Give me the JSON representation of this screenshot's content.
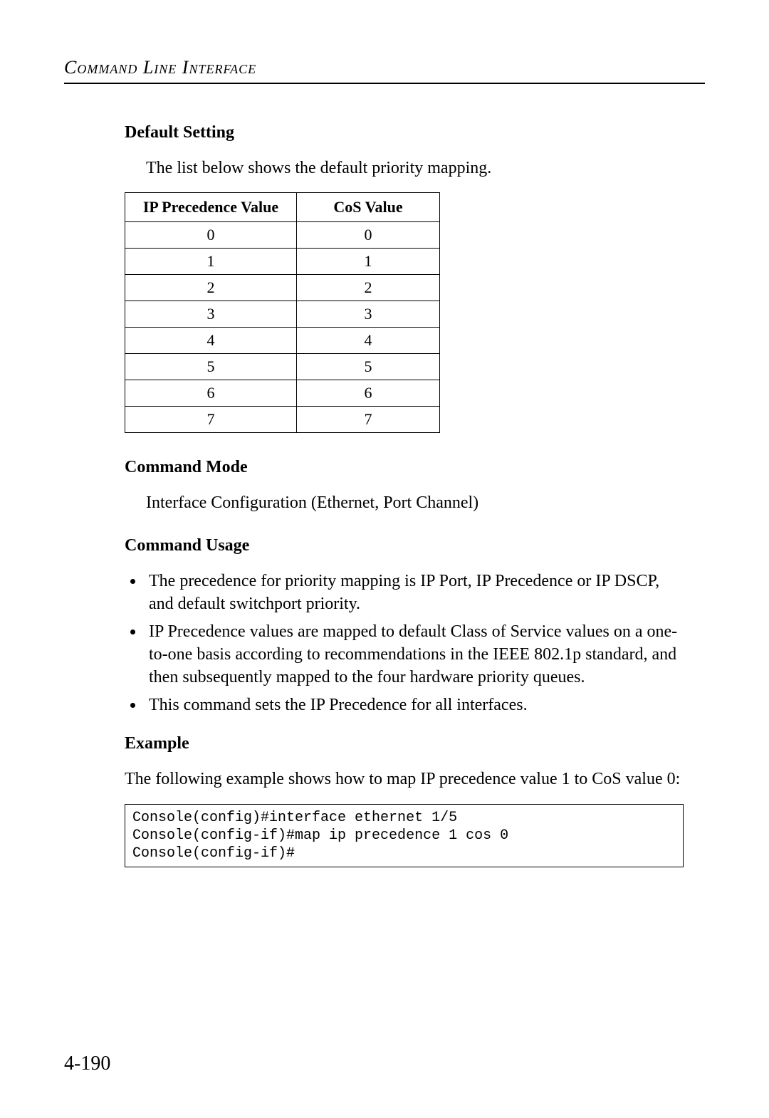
{
  "header": {
    "title": "Command Line Interface"
  },
  "sections": {
    "default_setting": {
      "heading": "Default Setting",
      "intro": "The list below shows the default priority mapping.",
      "table": {
        "headers": {
          "ip": "IP Precedence Value",
          "cos": "CoS Value"
        },
        "rows": [
          {
            "ip": "0",
            "cos": "0"
          },
          {
            "ip": "1",
            "cos": "1"
          },
          {
            "ip": "2",
            "cos": "2"
          },
          {
            "ip": "3",
            "cos": "3"
          },
          {
            "ip": "4",
            "cos": "4"
          },
          {
            "ip": "5",
            "cos": "5"
          },
          {
            "ip": "6",
            "cos": "6"
          },
          {
            "ip": "7",
            "cos": "7"
          }
        ]
      }
    },
    "command_mode": {
      "heading": "Command Mode",
      "text": "Interface Configuration (Ethernet, Port Channel)"
    },
    "command_usage": {
      "heading": "Command Usage",
      "items": [
        "The precedence for priority mapping is IP Port, IP Precedence or IP DSCP, and default switchport priority.",
        "IP Precedence values are mapped to default Class of Service values on a one-to-one basis according to recommendations in the IEEE 802.1p standard, and then subsequently mapped to the four hardware priority queues.",
        "This command sets the IP Precedence for all interfaces."
      ]
    },
    "example": {
      "heading": "Example",
      "intro": "The following example shows how to map IP precedence value 1 to CoS value 0:",
      "code": "Console(config)#interface ethernet 1/5\nConsole(config-if)#map ip precedence 1 cos 0\nConsole(config-if)#"
    }
  },
  "page_number": "4-190"
}
